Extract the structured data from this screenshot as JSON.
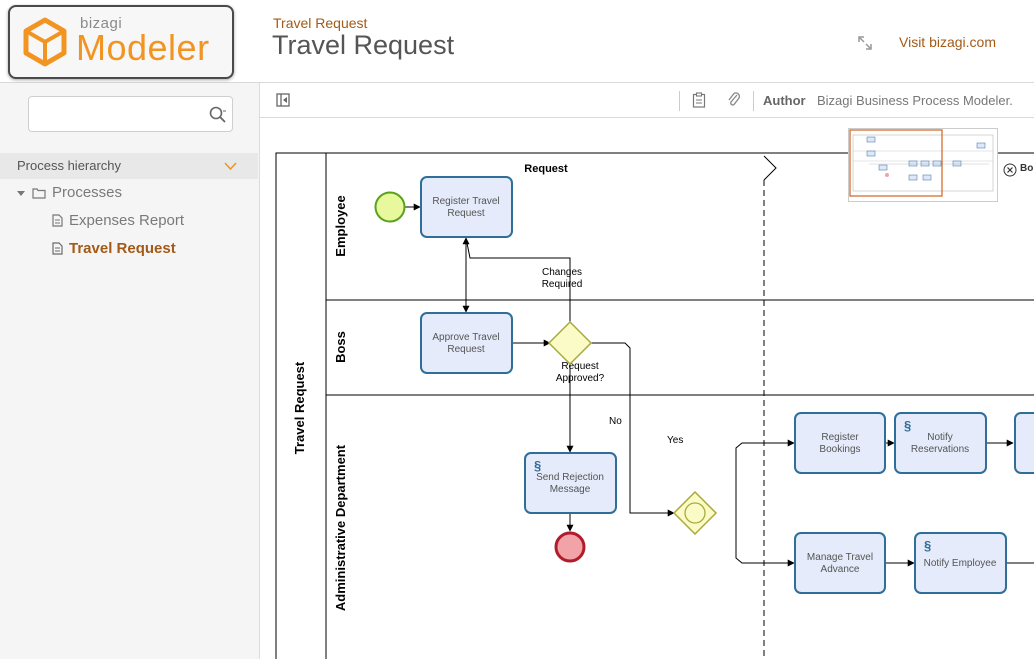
{
  "header": {
    "logo_small": "bizagi",
    "logo_big": "Modeler",
    "breadcrumb": "Travel Request",
    "title": "Travel Request",
    "visit_link": "Visit bizagi.com"
  },
  "sidebar": {
    "search_placeholder": "",
    "hierarchy_label": "Process hierarchy",
    "tree": {
      "root": "Processes",
      "children": [
        "Expenses Report",
        "Travel Request"
      ]
    }
  },
  "toolbar": {
    "author_label": "Author",
    "author_value": "Bizagi Business Process Modeler."
  },
  "diagram": {
    "pool": "Travel Request",
    "phase": "Request",
    "lanes": [
      "Employee",
      "Boss",
      "Administrative Department"
    ],
    "tasks": {
      "register": [
        "Register Travel",
        "Request"
      ],
      "approve": [
        "Approve Travel",
        "Request"
      ],
      "rejection": [
        "Send Rejection",
        "Message"
      ],
      "bookings": [
        "Register",
        "Bookings"
      ],
      "reservations": [
        "Notify",
        "Reservations"
      ],
      "advance": [
        "Manage Travel",
        "Advance"
      ],
      "notify_employee": [
        "Notify Employee"
      ]
    },
    "labels": {
      "changes": [
        "Changes",
        "Required"
      ],
      "approved": [
        "Request",
        "Approved?"
      ],
      "no": "No",
      "yes": "Yes",
      "minimap_close": "Bo"
    }
  },
  "colors": {
    "accent": "#f29422",
    "link": "#a35a17",
    "task_fill": "#e5ebfa",
    "task_stroke": "#2e6e99",
    "gateway_fill": "#fbfbc8",
    "gateway_stroke": "#a9a93c",
    "start_fill": "#e7f99c",
    "start_stroke": "#5aa21c",
    "end_fill": "#f2a3a8",
    "end_stroke": "#b01c2b"
  }
}
